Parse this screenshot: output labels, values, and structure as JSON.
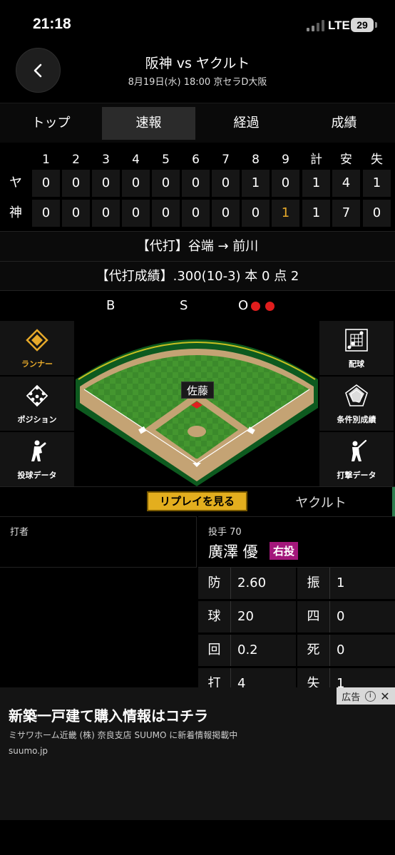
{
  "status": {
    "time": "21:18",
    "network": "LTE",
    "battery": "29"
  },
  "header": {
    "title": "阪神 vs ヤクルト",
    "subtitle": "8月19日(水) 18:00 京セラD大阪"
  },
  "tabs": [
    {
      "label": "トップ",
      "active": false
    },
    {
      "label": "速報",
      "active": true
    },
    {
      "label": "経過",
      "active": false
    },
    {
      "label": "成績",
      "active": false
    }
  ],
  "scoreboard": {
    "headers": [
      "1",
      "2",
      "3",
      "4",
      "5",
      "6",
      "7",
      "8",
      "9",
      "計",
      "安",
      "失"
    ],
    "rows": [
      {
        "team": "ヤ",
        "cells": [
          "0",
          "0",
          "0",
          "0",
          "0",
          "0",
          "0",
          "1",
          "0",
          "1",
          "4",
          "1"
        ]
      },
      {
        "team": "神",
        "cells": [
          "0",
          "0",
          "0",
          "0",
          "0",
          "0",
          "0",
          "0",
          "1",
          "1",
          "7",
          "0"
        ]
      }
    ]
  },
  "event_line": "【代打】谷端 → 前川",
  "pinch_stats": "【代打成績】.300(10-3) 本 0 点 2",
  "count": {
    "b_label": "B",
    "s_label": "S",
    "o_label": "O",
    "balls": 0,
    "strikes": 0,
    "outs": 2
  },
  "side_left": [
    {
      "label": "ランナー",
      "icon": "runner-diamond-icon",
      "active": true
    },
    {
      "label": "ポジション",
      "icon": "position-icon",
      "active": false
    },
    {
      "label": "投球データ",
      "icon": "pitcher-icon",
      "active": false
    }
  ],
  "side_right": [
    {
      "label": "配球",
      "icon": "pitch-grid-icon"
    },
    {
      "label": "条件別成績",
      "icon": "radar-chart-icon"
    },
    {
      "label": "打撃データ",
      "icon": "batter-icon"
    }
  ],
  "field": {
    "player_label": "佐藤"
  },
  "replay": {
    "button": "リプレイを見る",
    "team": "ヤクルト"
  },
  "batter": {
    "label": "打者"
  },
  "pitcher": {
    "label": "投手 70",
    "name": "廣澤 優",
    "hand": "右投"
  },
  "pitcher_stats": [
    {
      "k": "防",
      "v": "2.60"
    },
    {
      "k": "振",
      "v": "1"
    },
    {
      "k": "球",
      "v": "20"
    },
    {
      "k": "四",
      "v": "0"
    },
    {
      "k": "回",
      "v": "0.2"
    },
    {
      "k": "死",
      "v": "0"
    },
    {
      "k": "打",
      "v": "4"
    },
    {
      "k": "失",
      "v": "1"
    }
  ],
  "ad": {
    "badge": "広告",
    "title": "新築一戸建て購入情報はコチラ",
    "desc": "ミサワホーム近畿 (株) 奈良支店 SUUMO に新着情報掲載中",
    "url": "suumo.jp"
  },
  "colors": {
    "accent": "#e6a92a",
    "out_dot": "#e01d1d",
    "badge": "#a3177b",
    "field_green": "#3f8f2e"
  }
}
